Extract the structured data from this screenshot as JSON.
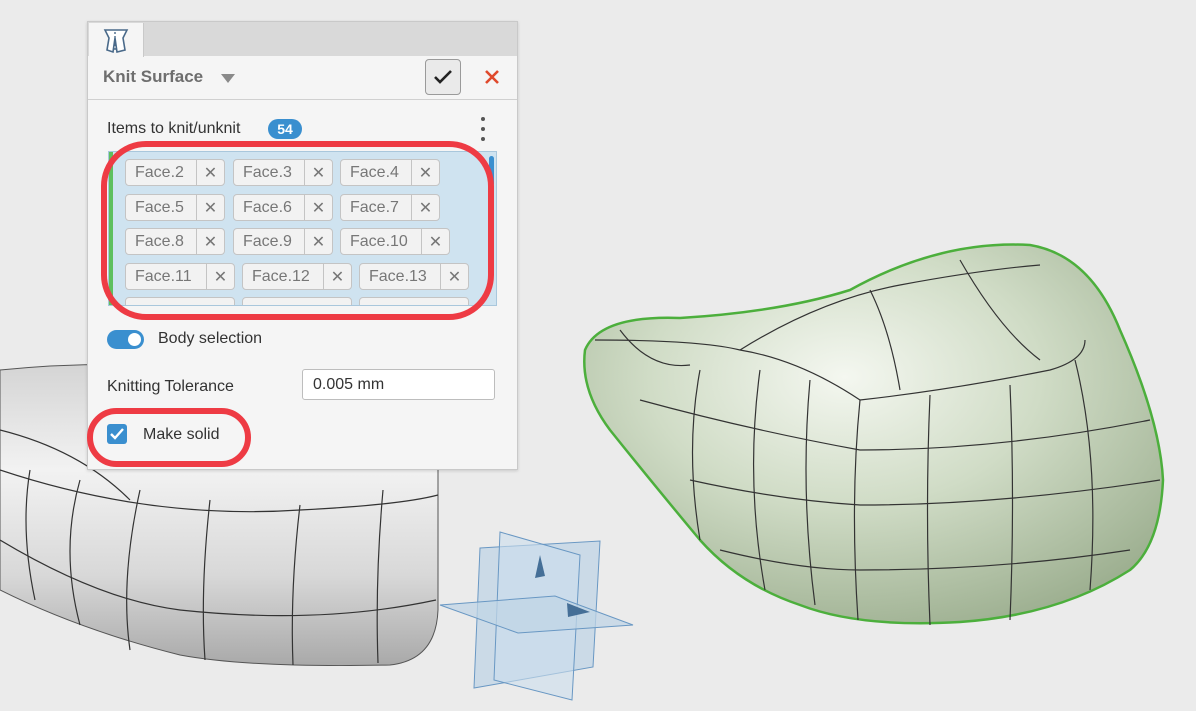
{
  "dialog": {
    "title": "Knit Surface",
    "tab_icon": "knit-surface-icon",
    "ok_icon": "checkmark-icon",
    "close_icon": "close-x-icon",
    "items_label": "Items to knit/unknit",
    "items_count": "54",
    "items": [
      "Face.2",
      "Face.3",
      "Face.4",
      "Face.5",
      "Face.6",
      "Face.7",
      "Face.8",
      "Face.9",
      "Face.10",
      "Face.11",
      "Face.12",
      "Face.13"
    ],
    "body_selection_label": "Body selection",
    "body_selection_on": true,
    "tolerance_label": "Knitting Tolerance",
    "tolerance_value": "0.005 mm",
    "make_solid_label": "Make solid",
    "make_solid_checked": true
  },
  "colors": {
    "accent": "#3a8fcf",
    "annotation": "#ee3b44",
    "selection_edge": "#5ec05e",
    "close": "#e0492c"
  }
}
